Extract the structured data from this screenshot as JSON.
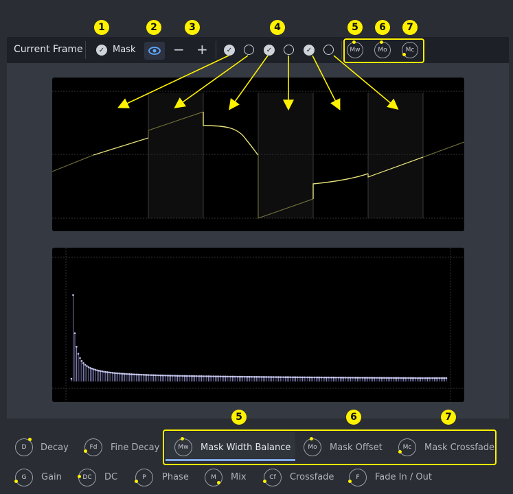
{
  "callouts": {
    "c1": "1",
    "c2": "2",
    "c3": "3",
    "c4": "4",
    "c5": "5",
    "c6": "6",
    "c7": "7",
    "b5": "5",
    "b6": "6",
    "b7": "7"
  },
  "toolbar": {
    "title": "Current Frame",
    "mask_label": "Mask",
    "minus": "−",
    "plus": "+"
  },
  "top_knobs": [
    {
      "abbr": "Mw"
    },
    {
      "abbr": "Mo"
    },
    {
      "abbr": "Mc"
    }
  ],
  "params_row1": [
    {
      "abbr": "D",
      "label": "Decay"
    },
    {
      "abbr": "Fd",
      "label": "Fine Decay"
    },
    {
      "abbr": "Mw",
      "label": "Mask Width Balance"
    },
    {
      "abbr": "Mo",
      "label": "Mask Offset"
    },
    {
      "abbr": "Mc",
      "label": "Mask Crossfade"
    }
  ],
  "params_row2": [
    {
      "abbr": "G",
      "label": "Gain"
    },
    {
      "abbr": "DC",
      "label": "DC"
    },
    {
      "abbr": "P",
      "label": "Phase"
    },
    {
      "abbr": "M",
      "label": "Mix"
    },
    {
      "abbr": "Cf",
      "label": "Crossfade"
    },
    {
      "abbr": "F",
      "label": "Fade In / Out"
    }
  ],
  "colors": {
    "accent": "#fff200",
    "eye": "#5fa8ff",
    "spectrum": "#9b9be0",
    "selected_underline": "#7fa9e6"
  }
}
